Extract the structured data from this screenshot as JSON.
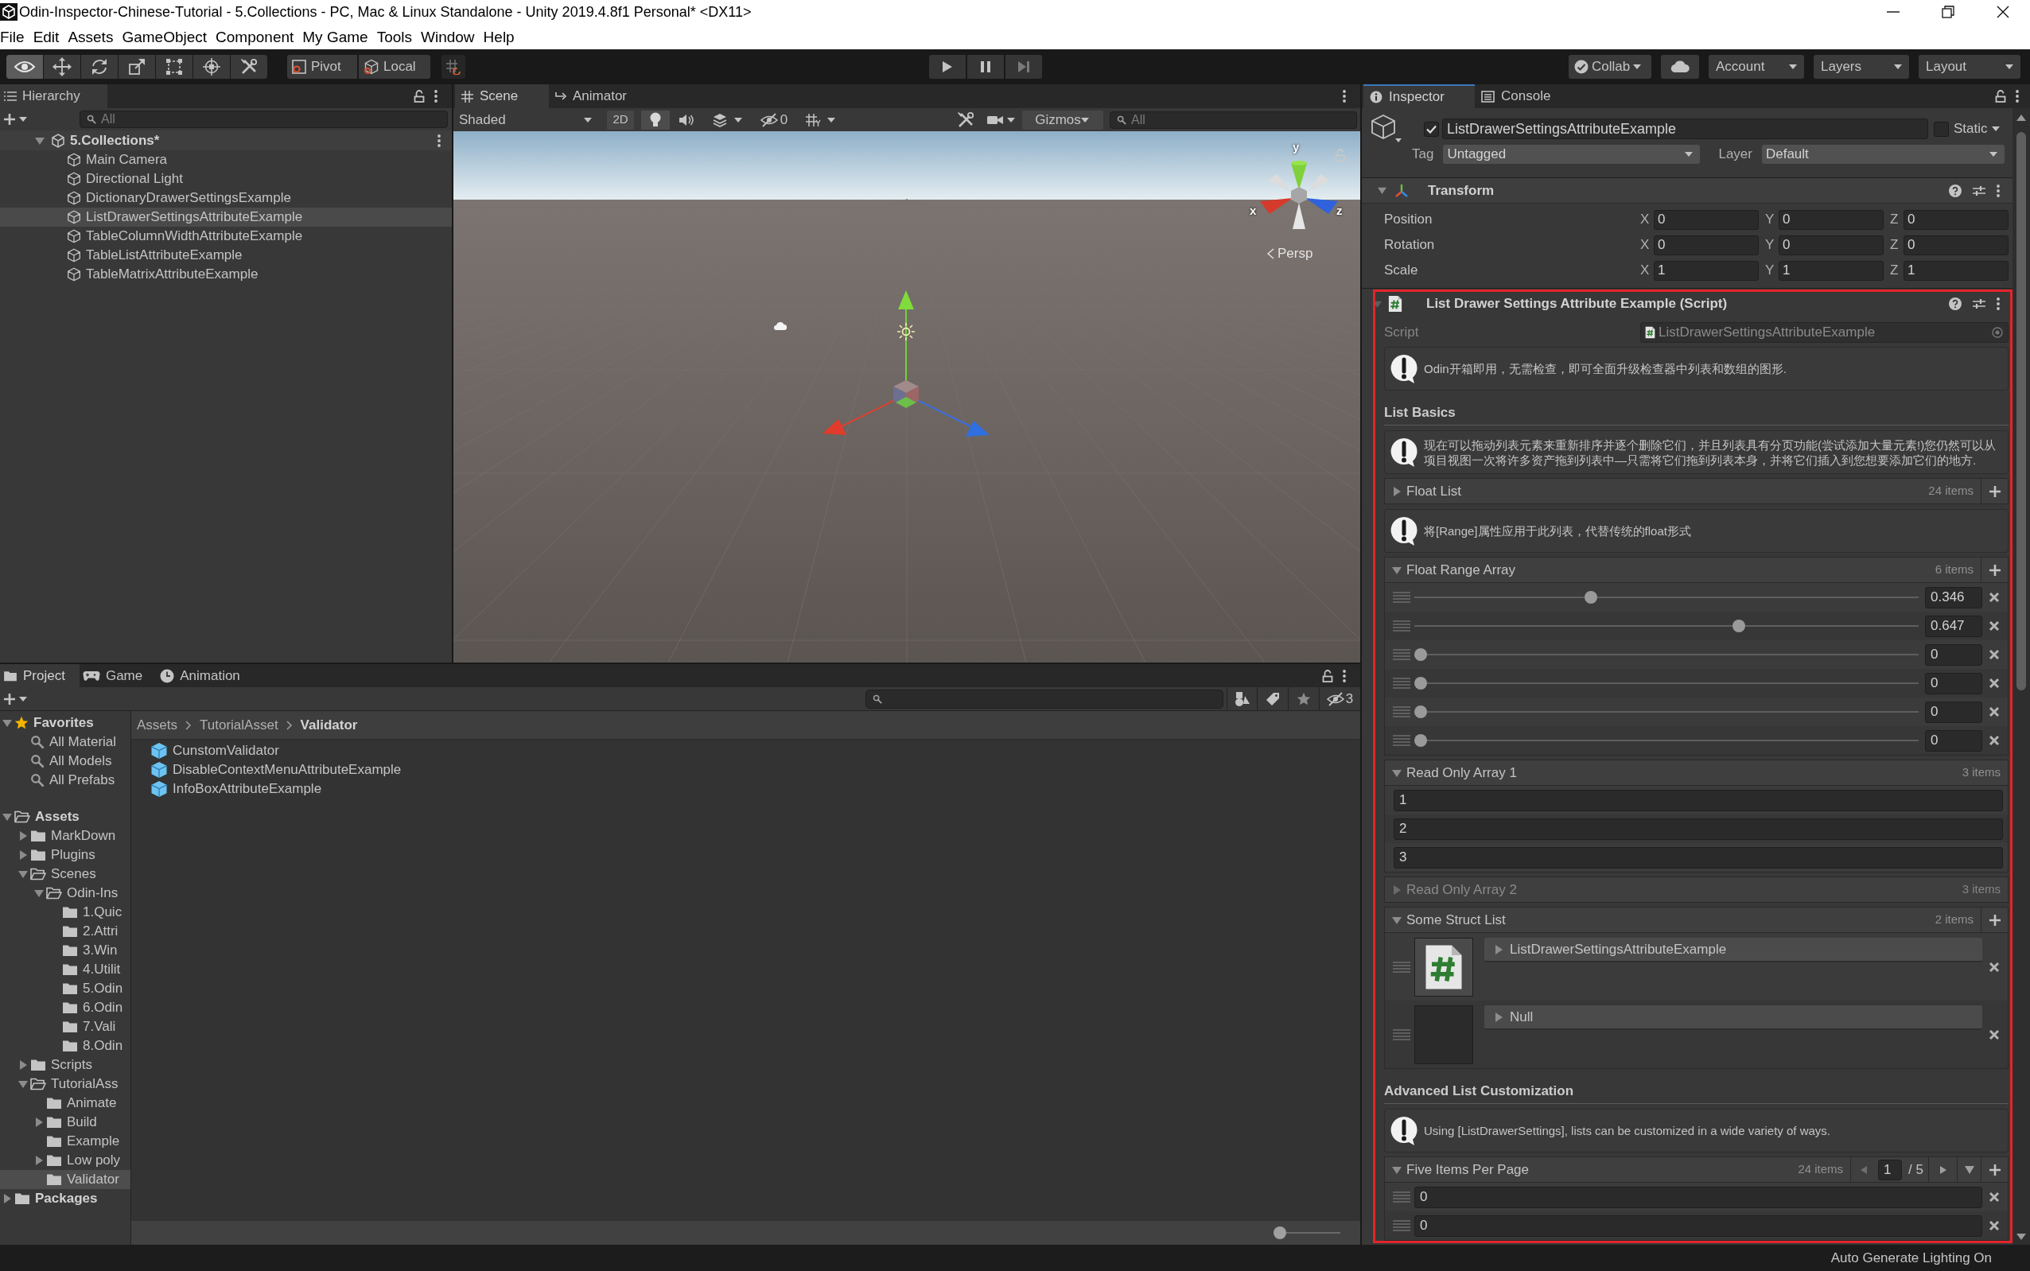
{
  "window": {
    "title": "Odin-Inspector-Chinese-Tutorial - 5.Collections - PC, Mac & Linux Standalone - Unity 2019.4.8f1 Personal* <DX11>"
  },
  "menu": [
    "File",
    "Edit",
    "Assets",
    "GameObject",
    "Component",
    "My Game",
    "Tools",
    "Window",
    "Help"
  ],
  "toolbar": {
    "tools": [
      {
        "selected": true
      },
      {
        "selected": false
      },
      {
        "selected": false
      },
      {
        "selected": false
      },
      {
        "selected": false
      },
      {
        "selected": false
      },
      {
        "selected": false
      }
    ],
    "pivot": "Pivot",
    "space": "Local",
    "collab": "Collab",
    "account": "Account",
    "layers": "Layers",
    "layout": "Layout"
  },
  "hierarchy": {
    "tab": "Hierarchy",
    "search_placeholder": "All",
    "scene": {
      "label": "5.Collections*",
      "expanded": true,
      "children": [
        {
          "label": "Main Camera",
          "selected": false
        },
        {
          "label": "Directional Light",
          "selected": false
        },
        {
          "label": "DictionaryDrawerSettingsExample",
          "selected": false
        },
        {
          "label": "ListDrawerSettingsAttributeExample",
          "selected": true
        },
        {
          "label": "TableColumnWidthAttributeExample",
          "selected": false
        },
        {
          "label": "TableListAttributeExample",
          "selected": false
        },
        {
          "label": "TableMatrixAttributeExample",
          "selected": false
        }
      ]
    }
  },
  "scene_view": {
    "tabs": [
      {
        "label": "Scene",
        "selected": true
      },
      {
        "label": "Animator",
        "selected": false
      }
    ],
    "shading": "Shaded",
    "mode_2d": "2D",
    "lighting": true,
    "hidden_count": "0",
    "gizmos": "Gizmos",
    "search_placeholder": "All",
    "gizmo_axes": [
      "y",
      "x",
      "z"
    ],
    "projection": "Persp"
  },
  "inspector": {
    "tabs": [
      {
        "label": "Inspector",
        "selected": true
      },
      {
        "label": "Console",
        "selected": false
      }
    ],
    "object": {
      "active": true,
      "name": "ListDrawerSettingsAttributeExample",
      "static": false,
      "static_label": "Static",
      "tag_label": "Tag",
      "tag": "Untagged",
      "layer_label": "Layer",
      "layer": "Default"
    },
    "transform": {
      "title": "Transform",
      "expanded": true,
      "rows": [
        {
          "label": "Position",
          "fields": [
            {
              "axis": "X",
              "value": "0"
            },
            {
              "axis": "Y",
              "value": "0"
            },
            {
              "axis": "Z",
              "value": "0"
            }
          ]
        },
        {
          "label": "Rotation",
          "fields": [
            {
              "axis": "X",
              "value": "0"
            },
            {
              "axis": "Y",
              "value": "0"
            },
            {
              "axis": "Z",
              "value": "0"
            }
          ]
        },
        {
          "label": "Scale",
          "fields": [
            {
              "axis": "X",
              "value": "1"
            },
            {
              "axis": "Y",
              "value": "1"
            },
            {
              "axis": "Z",
              "value": "1"
            }
          ]
        }
      ]
    },
    "component": {
      "title": "List Drawer Settings Attribute Example (Script)",
      "expanded": true,
      "highlighted": true,
      "script_label": "Script",
      "script": "ListDrawerSettingsAttributeExample",
      "items": [
        {
          "kind": "info",
          "text": "Odin开箱即用，无需检查，即可全面升级检查器中列表和数组的图形."
        },
        {
          "kind": "heading",
          "text": "List Basics"
        },
        {
          "kind": "info",
          "text": "现在可以拖动列表元素来重新排序并逐个删除它们，并且列表具有分页功能(尝试添加大量元素!)您仍然可以从项目视图一次将许多资产拖到列表中—只需将它们拖到列表本身，并将它们插入到您想要添加它们的地方."
        },
        {
          "kind": "list",
          "label": "Float List",
          "count": "24 items",
          "expanded": false,
          "disabled": false,
          "can_add": true
        },
        {
          "kind": "info",
          "text": "将[Range]属性应用于此列表，代替传统的float形式"
        },
        {
          "kind": "list",
          "label": "Float Range Array",
          "count": "6 items",
          "expanded": true,
          "disabled": false,
          "can_add": true,
          "elements": [
            {
              "kind": "slider",
              "level": 0.346,
              "value": "0.346"
            },
            {
              "kind": "slider",
              "level": 0.647,
              "value": "0.647"
            },
            {
              "kind": "slider",
              "level": 0,
              "value": "0"
            },
            {
              "kind": "slider",
              "level": 0,
              "value": "0"
            },
            {
              "kind": "slider",
              "level": 0,
              "value": "0"
            },
            {
              "kind": "slider",
              "level": 0,
              "value": "0"
            }
          ]
        },
        {
          "kind": "list",
          "label": "Read Only Array 1",
          "count": "3 items",
          "expanded": true,
          "disabled": false,
          "can_add": false,
          "elements": [
            {
              "kind": "readonly",
              "value": "1"
            },
            {
              "kind": "readonly",
              "value": "2"
            },
            {
              "kind": "readonly",
              "value": "3"
            }
          ]
        },
        {
          "kind": "list",
          "label": "Read Only Array 2",
          "count": "3 items",
          "expanded": false,
          "disabled": true,
          "can_add": false
        },
        {
          "kind": "list",
          "label": "Some Struct List",
          "count": "2 items",
          "expanded": true,
          "disabled": false,
          "can_add": true,
          "elements": [
            {
              "kind": "object",
              "label": "ListDrawerSettingsAttributeExample",
              "expanded": false,
              "has_preview": true
            },
            {
              "kind": "object",
              "label": "Null",
              "expanded": false,
              "has_preview": false
            }
          ]
        },
        {
          "kind": "heading",
          "text": "Advanced List Customization"
        },
        {
          "kind": "info",
          "text": "Using [ListDrawerSettings], lists can be customized in a wide variety of ways."
        },
        {
          "kind": "list",
          "label": "Five Items Per Page",
          "count": "24 items",
          "expanded": true,
          "disabled": false,
          "can_add": true,
          "paging": {
            "page": "1",
            "total": "/ 5"
          },
          "elements": [
            {
              "kind": "number",
              "value": "0"
            },
            {
              "kind": "number",
              "value": "0"
            }
          ]
        }
      ]
    }
  },
  "project": {
    "tabs": [
      {
        "label": "Project",
        "selected": true
      },
      {
        "label": "Game",
        "selected": false
      },
      {
        "label": "Animation",
        "selected": false
      }
    ],
    "hidden_count": "3",
    "tree": [
      {
        "kind": "favorites",
        "label": "Favorites",
        "expanded": true,
        "selected": false,
        "children": [
          {
            "kind": "search",
            "label": "All Material",
            "selected": false
          },
          {
            "kind": "search",
            "label": "All Models",
            "selected": false
          },
          {
            "kind": "search",
            "label": "All Prefabs",
            "selected": false
          }
        ]
      },
      {
        "kind": "folder",
        "label": "Assets",
        "expanded": true,
        "selected": false,
        "children": [
          {
            "kind": "folder",
            "label": "MarkDown",
            "expanded": false,
            "selected": false
          },
          {
            "kind": "folder",
            "label": "Plugins",
            "expanded": false,
            "selected": false
          },
          {
            "kind": "folder",
            "label": "Scenes",
            "expanded": true,
            "selected": false,
            "children": [
              {
                "kind": "folder",
                "label": "Odin-Ins",
                "expanded": true,
                "selected": false,
                "children": [
                  {
                    "kind": "folder",
                    "label": "1.Quic",
                    "selected": false
                  },
                  {
                    "kind": "folder",
                    "label": "2.Attri",
                    "selected": false
                  },
                  {
                    "kind": "folder",
                    "label": "3.Win",
                    "selected": false
                  },
                  {
                    "kind": "folder",
                    "label": "4.Utilit",
                    "selected": false
                  },
                  {
                    "kind": "folder",
                    "label": "5.Odin",
                    "selected": false
                  },
                  {
                    "kind": "folder",
                    "label": "6.Odin",
                    "selected": false
                  },
                  {
                    "kind": "folder",
                    "label": "7.Vali",
                    "selected": false
                  },
                  {
                    "kind": "folder",
                    "label": "8.Odin",
                    "selected": false
                  }
                ]
              }
            ]
          },
          {
            "kind": "folder",
            "label": "Scripts",
            "expanded": false,
            "selected": false
          },
          {
            "kind": "folder",
            "label": "TutorialAss",
            "expanded": true,
            "selected": false,
            "children": [
              {
                "kind": "folder",
                "label": "Animate",
                "selected": false
              },
              {
                "kind": "folder",
                "label": "Build",
                "expanded": false,
                "selected": false
              },
              {
                "kind": "folder",
                "label": "Example",
                "selected": false
              },
              {
                "kind": "folder",
                "label": "Low poly",
                "expanded": false,
                "selected": false
              },
              {
                "kind": "folder",
                "label": "Validator",
                "selected": true
              }
            ]
          }
        ]
      },
      {
        "kind": "folder",
        "label": "Packages",
        "expanded": false,
        "selected": false
      }
    ],
    "breadcrumb": [
      "Assets",
      "TutorialAsset",
      "Validator"
    ],
    "files": [
      "CunstomValidator",
      "DisableContextMenuAttributeExample",
      "InfoBoxAttributeExample"
    ],
    "icon_size": {
      "level": 0
    }
  },
  "status_bar": {
    "text": "Auto Generate Lighting On"
  }
}
